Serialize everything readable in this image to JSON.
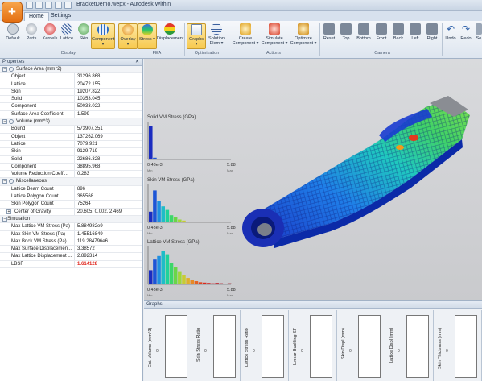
{
  "window": {
    "title": "BracketDemo.wepx - Autodesk Within"
  },
  "app_logo": {
    "glyph": "+"
  },
  "tabs": [
    {
      "label": "Home"
    },
    {
      "label": "Settings"
    }
  ],
  "ribbon": {
    "display_buttons": [
      "Default",
      "Parts",
      "Kernels",
      "Lattice",
      "Skin",
      "Component ▾",
      "Overlay ▾",
      "Stress ▾",
      "Displacement"
    ],
    "display_group": "Display",
    "fea_group": "FEA",
    "optimization_buttons": [
      "Graphs ▾",
      "Solution Elem ▾"
    ],
    "optimization_group": "Optimization",
    "action_buttons": [
      "Create Component ▾",
      "Simulate Component ▾",
      "Optimize Component ▾"
    ],
    "actions_group": "Actions",
    "camera_buttons": [
      "Reset",
      "Top",
      "Bottom",
      "Front",
      "Back",
      "Left",
      "Right"
    ],
    "camera_group": "Camera",
    "edit_buttons": [
      "Undo",
      "Redo",
      "Se"
    ]
  },
  "properties": {
    "header": "Properties",
    "rows": [
      {
        "type": "section",
        "label": "Surface Area (mm^2)"
      },
      {
        "label": "Object",
        "value": "31296.868"
      },
      {
        "label": "Lattice",
        "value": "20472.155"
      },
      {
        "label": "Skin",
        "value": "19207.822"
      },
      {
        "label": "Solid",
        "value": "10353.045"
      },
      {
        "label": "Component",
        "value": "50033.022"
      },
      {
        "label": "Surface Area Coefficient",
        "value": "1.599"
      },
      {
        "type": "section",
        "label": "Volume (mm^3)"
      },
      {
        "label": "Bound",
        "value": "573907.351"
      },
      {
        "label": "Object",
        "value": "137262.069"
      },
      {
        "label": "Lattice",
        "value": "7079.921"
      },
      {
        "label": "Skin",
        "value": "9129.719"
      },
      {
        "label": "Solid",
        "value": "22686.328"
      },
      {
        "label": "Component",
        "value": "38895.968"
      },
      {
        "label": "Volume Reduction Coeffi...",
        "value": "0.283"
      },
      {
        "type": "section",
        "label": "Miscellaneous"
      },
      {
        "label": "Lattice Beam Count",
        "value": "896"
      },
      {
        "label": "Lattice Polygon Count",
        "value": "365568"
      },
      {
        "label": "Skin Polygon Count",
        "value": "75264"
      },
      {
        "label": "Center of Gravity",
        "value": "20.605, 0.002, 2.469",
        "expand": true
      },
      {
        "type": "section2",
        "label": "Simulation"
      },
      {
        "label": "Max Lattice VM Stress (Pa)",
        "value": "5.884982e9"
      },
      {
        "label": "Max Skin VM Stress (Pa)",
        "value": "1.45516849"
      },
      {
        "label": "Max Brick VM Stress (Pa)",
        "value": "119.284796e6"
      },
      {
        "label": "Max Surface Displacemen...",
        "value": "3.38572"
      },
      {
        "label": "Max Lattice Displacement ...",
        "value": "2.892314"
      },
      {
        "label": "LBSF",
        "value": "1.614128",
        "highlight": true
      }
    ]
  },
  "histograms": [
    {
      "title": "Solid VM Stress (GPa)",
      "min": "0.43e-3",
      "max": "5.88",
      "min_label": "Min",
      "max_label": "Max",
      "bins": [
        0.95,
        0.05,
        0.02,
        0,
        0,
        0,
        0,
        0,
        0,
        0,
        0,
        0,
        0,
        0,
        0,
        0,
        0,
        0,
        0,
        0
      ]
    },
    {
      "title": "Skin VM Stress (GPa)",
      "min": "0.43e-3",
      "max": "5.88",
      "min_label": "Min",
      "max_label": "Max",
      "bins": [
        0.3,
        0.9,
        0.6,
        0.45,
        0.35,
        0.2,
        0.15,
        0.08,
        0.05,
        0.02,
        0.01,
        0,
        0,
        0,
        0,
        0,
        0,
        0,
        0,
        0
      ]
    },
    {
      "title": "Lattice VM Stress (GPa)",
      "min": "0.43e-3",
      "max": "5.88",
      "min_label": "Min",
      "max_label": "Max",
      "bins": [
        0.4,
        0.7,
        0.8,
        0.95,
        0.85,
        0.6,
        0.5,
        0.35,
        0.25,
        0.18,
        0.12,
        0.09,
        0.06,
        0.05,
        0.04,
        0.03,
        0.04,
        0.03,
        0.02,
        0.03
      ]
    }
  ],
  "graphs": {
    "header": "Graphs",
    "panels": [
      {
        "label": "Est. Volume (mm^3)",
        "value": "0"
      },
      {
        "label": "Skin Stress Ratio",
        "value": "0"
      },
      {
        "label": "Lattice Stress Ratio",
        "value": "0"
      },
      {
        "label": "Linear Buckling SF",
        "value": "0"
      },
      {
        "label": "Skin Displ (mm)",
        "value": "0"
      },
      {
        "label": "Lattice Displ (mm)",
        "value": "0"
      },
      {
        "label": "Skin Thickness (mm)",
        "value": "0"
      }
    ]
  }
}
